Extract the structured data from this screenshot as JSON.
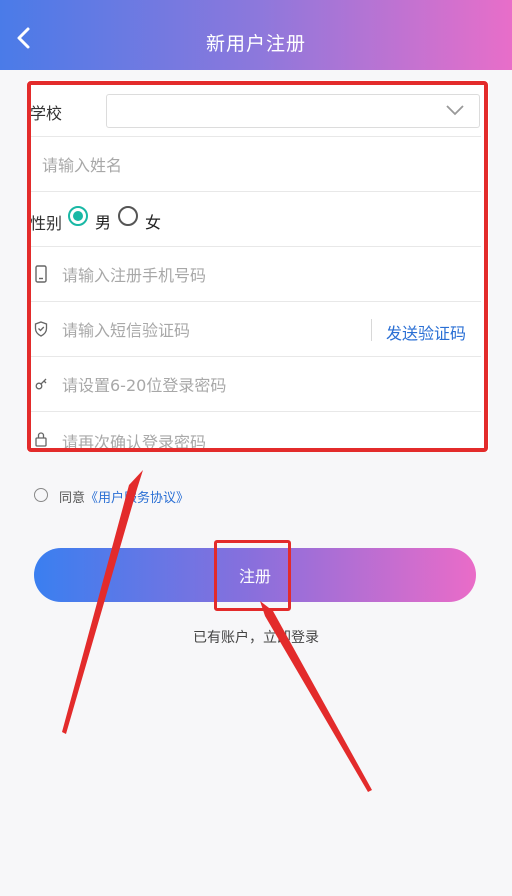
{
  "header": {
    "title": "新用户注册"
  },
  "form": {
    "school_label": "学校",
    "name_placeholder": "请输入姓名",
    "gender_label": "性别",
    "gender_options": [
      "男",
      "女"
    ],
    "gender_selected": "男",
    "phone_placeholder": "请输入注册手机号码",
    "sms_placeholder": "请输入短信验证码",
    "sms_button": "发送验证码",
    "password_placeholder": "请设置6-20位登录密码",
    "confirm_placeholder": "请再次确认登录密码"
  },
  "agreement": {
    "prefix": "同意",
    "link": "《用户服务协议》"
  },
  "actions": {
    "register": "注册",
    "login_link": "已有账户，立即登录"
  },
  "colors": {
    "accent": "#19b8a5",
    "link": "#2a6fd4",
    "highlight": "#e32b2b"
  }
}
